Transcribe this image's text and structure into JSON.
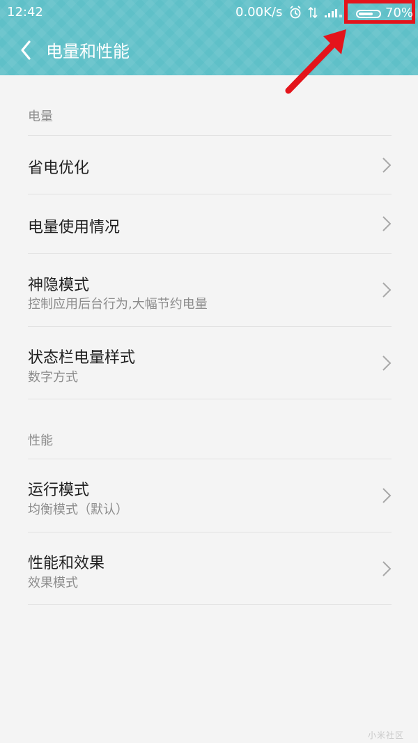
{
  "status_bar": {
    "time": "12:42",
    "network_speed": "0.00K/s",
    "battery_percent": "70%",
    "battery_level": 0.7,
    "icons": [
      "alarm-icon",
      "signal-arrows-icon",
      "cell-signal-icon"
    ]
  },
  "header": {
    "back_icon": "back-chevron-icon",
    "title": "电量和性能",
    "color": "#5fc0c8"
  },
  "annotation": {
    "highlight_color": "#e4141b"
  },
  "sections": {
    "battery": {
      "label": "电量",
      "items": [
        {
          "title": "省电优化",
          "subtitle": ""
        },
        {
          "title": "电量使用情况",
          "subtitle": ""
        },
        {
          "title": "神隐模式",
          "subtitle": "控制应用后台行为,大幅节约电量"
        },
        {
          "title": "状态栏电量样式",
          "subtitle": "数字方式"
        }
      ]
    },
    "performance": {
      "label": "性能",
      "items": [
        {
          "title": "运行模式",
          "subtitle": "均衡模式（默认）"
        },
        {
          "title": "性能和效果",
          "subtitle": "效果模式"
        }
      ]
    }
  },
  "watermark": "小米社区"
}
